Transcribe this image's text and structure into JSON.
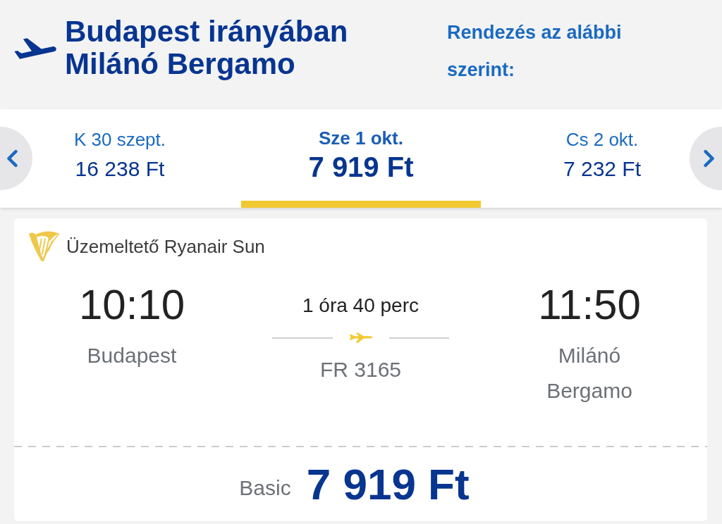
{
  "header": {
    "title": "Budapest irányában Milánó Bergamo",
    "sort_label": "Rendezés az alábbi szerint:"
  },
  "date_selector": {
    "dates": [
      {
        "date": "K 30 szept.",
        "price": "16 238 Ft",
        "selected": false
      },
      {
        "date": "Sze 1 okt.",
        "price": "7 919 Ft",
        "selected": true
      },
      {
        "date": "Cs 2 okt.",
        "price": "7 232 Ft",
        "selected": false
      }
    ]
  },
  "flight": {
    "operator": "Üzemeltető Ryanair Sun",
    "departure": {
      "time": "10:10",
      "city": "Budapest"
    },
    "duration": "1 óra 40 perc",
    "flight_number": "FR 3165",
    "arrival": {
      "time": "11:50",
      "city": "Milánó Bergamo"
    },
    "fare": {
      "name": "Basic",
      "price": "7 919 Ft"
    }
  }
}
